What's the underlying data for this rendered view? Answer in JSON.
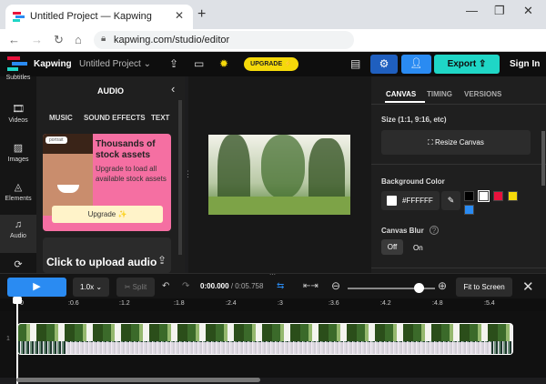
{
  "browser": {
    "tab_title": "Untitled Project — Kapwing",
    "tab_close": "✕",
    "new_tab": "+",
    "url": "kapwing.com/studio/editor",
    "window_controls": {
      "minimize": "—",
      "restore": "❐",
      "close": "✕"
    }
  },
  "header": {
    "brand": "Kapwing",
    "project": "Untitled Project ⌄",
    "upgrade": "UPGRADE ⚡",
    "export": "Export",
    "sign_in": "Sign In"
  },
  "rail": {
    "items": [
      {
        "label": "Subtitles",
        "icon": "subtitles-icon"
      },
      {
        "label": "Videos",
        "icon": "film-icon"
      },
      {
        "label": "Images",
        "icon": "image-icon"
      },
      {
        "label": "Elements",
        "icon": "shapes-icon"
      },
      {
        "label": "Audio",
        "icon": "music-icon"
      },
      {
        "label": "",
        "icon": "transitions-icon"
      }
    ]
  },
  "audio_panel": {
    "title": "AUDIO",
    "tabs": [
      "MUSIC",
      "SOUND EFFECTS",
      "TEXT"
    ],
    "promo": {
      "chip": "portrait",
      "title": "Thousands of stock assets",
      "body": "Upgrade to load all available stock assets",
      "button": "Upgrade ✨"
    },
    "upload": "Click to upload audio"
  },
  "properties": {
    "tabs": [
      "CANVAS",
      "TIMING",
      "VERSIONS"
    ],
    "size_label": "Size (1:1, 9:16, etc)",
    "resize_button": "Resize Canvas",
    "bg_label": "Background Color",
    "bg_hex": "#FFFFFF",
    "swatches": [
      "#000000",
      "#ffffff",
      "#e8123c",
      "#f5d90a",
      "#2a8bf2"
    ],
    "blur_label": "Canvas Blur",
    "blur_help": "?",
    "blur_off": "Off",
    "blur_on": "On"
  },
  "timeline": {
    "speed": "1.0x ⌄",
    "split": "✂ Split",
    "current_time": "0:00.000",
    "total_time": "/ 0:05.758",
    "fit": "Fit to Screen",
    "track_number": "1",
    "ruler": [
      "0",
      ":0.6",
      ":1.2",
      ":1.8",
      ":2.4",
      ":3",
      ":3.6",
      ":4.2",
      ":4.8",
      ":5.4"
    ]
  }
}
